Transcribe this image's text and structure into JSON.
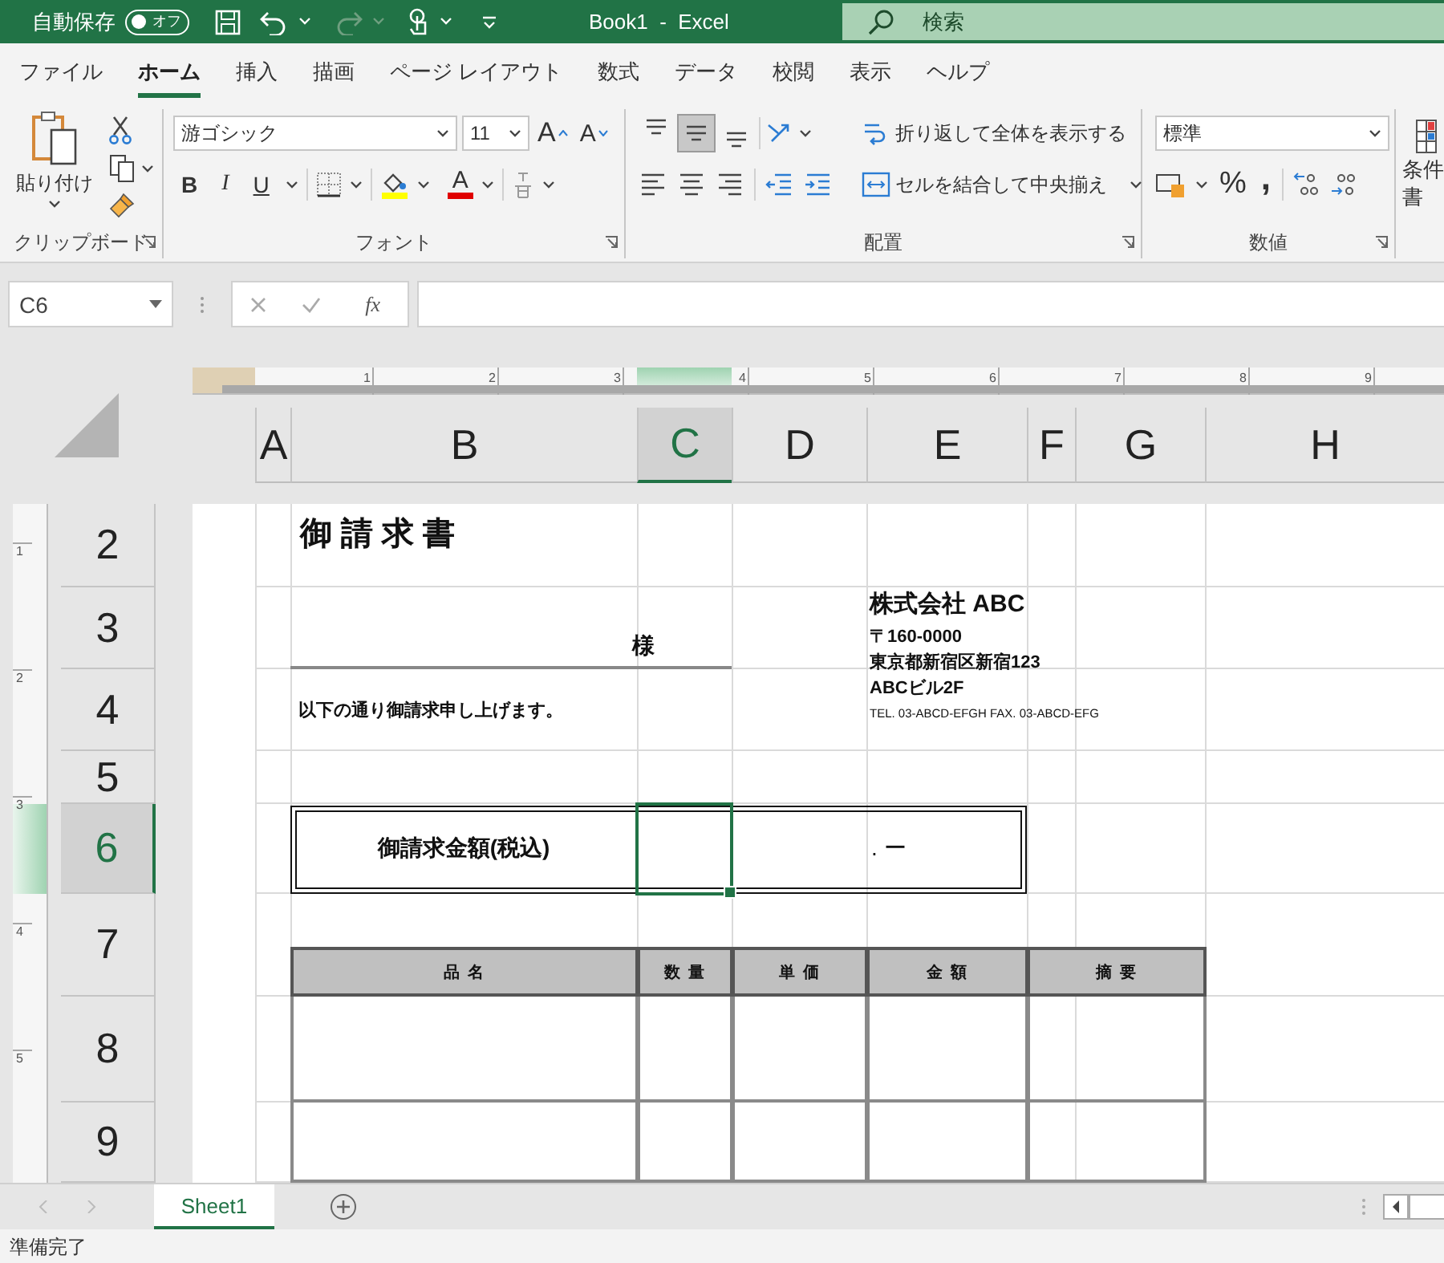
{
  "title_bar": {
    "autosave_label": "自動保存",
    "autosave_toggle": {
      "label": "オフ",
      "on": false
    },
    "redo_enabled": false,
    "document_title": "Book1  -  Excel",
    "search": {
      "placeholder": "検索"
    }
  },
  "ribbon_tabs": [
    {
      "label": "ファイル",
      "selected": false
    },
    {
      "label": "ホーム",
      "selected": true
    },
    {
      "label": "挿入",
      "selected": false
    },
    {
      "label": "描画",
      "selected": false
    },
    {
      "label": "ページ レイアウト",
      "selected": false
    },
    {
      "label": "数式",
      "selected": false
    },
    {
      "label": "データ",
      "selected": false
    },
    {
      "label": "校閲",
      "selected": false
    },
    {
      "label": "表示",
      "selected": false
    },
    {
      "label": "ヘルプ",
      "selected": false
    }
  ],
  "ribbon": {
    "clipboard": {
      "paste_label": "貼り付け",
      "group_label": "クリップボード"
    },
    "font": {
      "font_name": "游ゴシック",
      "font_size": "11",
      "grow_label": "A",
      "shrink_label": "A",
      "bold_label": "B",
      "italic_label": "I",
      "underline_label": "U",
      "font_color_label": "A",
      "group_label": "フォント"
    },
    "alignment": {
      "vertical_align": [
        {
          "selected": false
        },
        {
          "selected": true
        },
        {
          "selected": false
        }
      ],
      "wrap_text_label": "折り返して全体を表示する",
      "merge_label": "セルを結合して中央揃え",
      "group_label": "配置"
    },
    "number": {
      "format": "標準",
      "percent_label": "%",
      "comma_label": ",",
      "group_label": "数値"
    },
    "styles": {
      "label_lines": [
        "条件",
        "書"
      ]
    }
  },
  "formula_bar": {
    "name_box": "C6",
    "function_label": "fx"
  },
  "rulers": {
    "horizontal_ticks": [
      "1",
      "2",
      "3",
      "4",
      "5",
      "6",
      "7",
      "8",
      "9"
    ],
    "vertical_ticks": [
      "1",
      "2",
      "3",
      "4",
      "5"
    ]
  },
  "columns": [
    {
      "label": "A",
      "selected": false
    },
    {
      "label": "B",
      "selected": false
    },
    {
      "label": "C",
      "selected": true
    },
    {
      "label": "D",
      "selected": false
    },
    {
      "label": "E",
      "selected": false
    },
    {
      "label": "F",
      "selected": false
    },
    {
      "label": "G",
      "selected": false
    },
    {
      "label": "H",
      "selected": false
    }
  ],
  "rows": [
    {
      "label": "2",
      "selected": false
    },
    {
      "label": "3",
      "selected": false
    },
    {
      "label": "4",
      "selected": false
    },
    {
      "label": "5",
      "selected": false
    },
    {
      "label": "6",
      "selected": true
    },
    {
      "label": "7",
      "selected": false
    },
    {
      "label": "8",
      "selected": false
    },
    {
      "label": "9",
      "selected": false
    }
  ],
  "invoice": {
    "title": "御 請 求 書",
    "recipient_suffix": "様",
    "greeting": "以下の通り御請求申し上げます。",
    "company": {
      "name": "株式会社 ABC",
      "postal": "〒160-0000",
      "address": "東京都新宿区新宿123",
      "building": "ABCビル2F",
      "contact": "TEL. 03-ABCD-EFGH FAX. 03-ABCD-EFG"
    },
    "amount_label": "御請求金額(税込)",
    "amount_value": ". ー",
    "table_headers": [
      "品 名",
      "数 量",
      "単 価",
      "金 額",
      "摘 要"
    ]
  },
  "sheet_tabs": [
    {
      "label": "Sheet1",
      "selected": true
    }
  ],
  "status_bar": {
    "text": "準備完了"
  }
}
